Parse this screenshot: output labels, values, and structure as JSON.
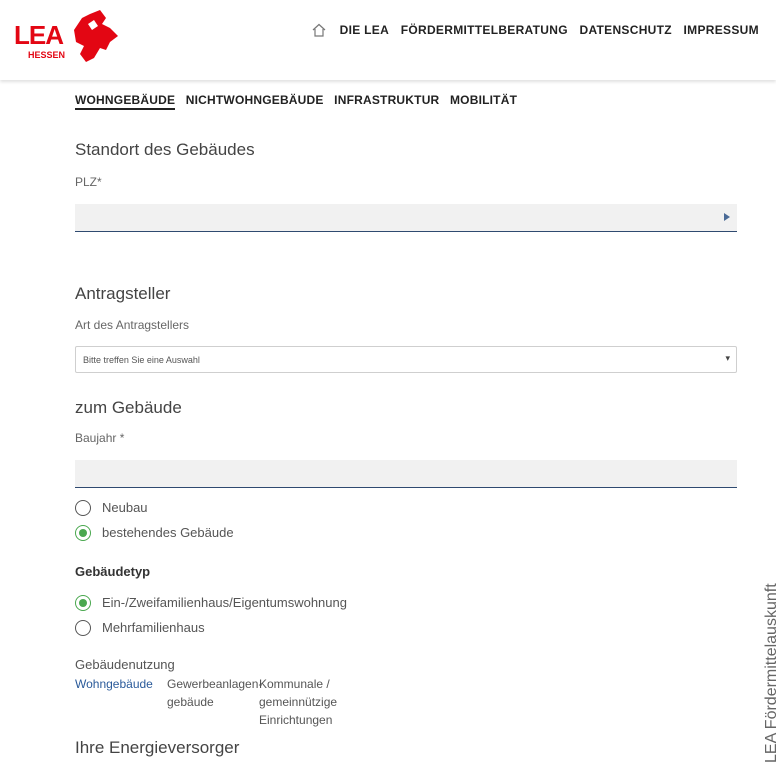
{
  "header": {
    "logo_text": "LEA",
    "logo_sub": "HESSEN",
    "nav": [
      "DIE LEA",
      "FÖRDERMITTELBERATUNG",
      "DATENSCHUTZ",
      "IMPRESSUM"
    ]
  },
  "tabs": [
    "WOHNGEBÄUDE",
    "NICHTWOHNGEBÄUDE",
    "INFRASTRUKTUR",
    "MOBILITÄT"
  ],
  "standort": {
    "title": "Standort des Gebäudes",
    "plz_label": "PLZ*"
  },
  "antragsteller": {
    "title": "Antragsteller",
    "art_label": "Art des Antragstellers",
    "select_value": "Bitte treffen Sie eine Auswahl"
  },
  "gebaeude": {
    "title": "zum Gebäude",
    "baujahr_label": "Baujahr *",
    "radio_neubau": "Neubau",
    "radio_bestehend": "bestehendes Gebäude",
    "typ_label": "Gebäudetyp",
    "radio_efh": "Ein-/Zweifamilienhaus/Eigentumswohnung",
    "radio_mfh": "Mehrfamilienhaus",
    "nutzung_label": "Gebäudenutzung",
    "nutzung_tabs": [
      "Wohngebäude",
      "Gewerbeanlagen- gebäude",
      "Kommunale / gemeinnützige Einrichtungen"
    ]
  },
  "energie": {
    "title": "Ihre Energieversorger"
  },
  "vertical_text": "LEA Fördermittelauskunft",
  "colors": {
    "accent_red": "#e30613",
    "radio_green": "#4aa84f",
    "link_blue": "#2a5a9a"
  }
}
